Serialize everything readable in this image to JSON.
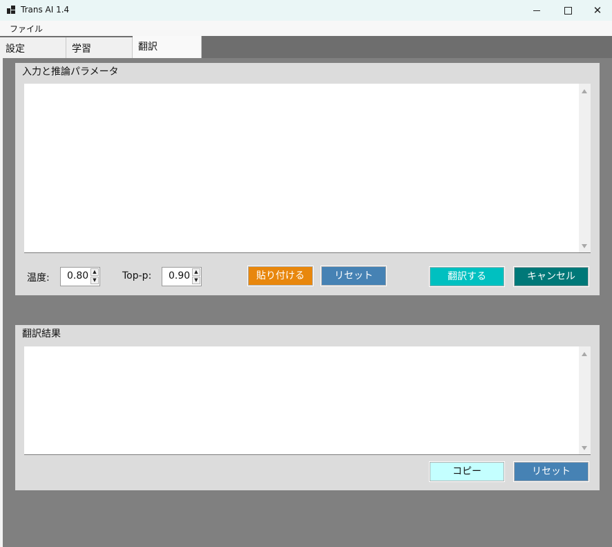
{
  "window": {
    "title": "Trans AI 1.4",
    "minimize_icon": "minimize-icon",
    "maximize_icon": "maximize-icon",
    "close_icon": "close-icon"
  },
  "menu": {
    "items": [
      {
        "label": "ファイル"
      }
    ]
  },
  "tabs": [
    {
      "label": "設定"
    },
    {
      "label": "学習"
    },
    {
      "label": "翻訳"
    }
  ],
  "active_tab": "翻訳",
  "input_group": {
    "title": "入力と推論パラメータ",
    "text": "",
    "temperature_label": "温度:",
    "temperature_value": "0.80",
    "top_p_label": "Top-p:",
    "top_p_value": "0.90",
    "paste_label": "貼り付ける",
    "reset_label": "リセット",
    "translate_label": "翻訳する",
    "cancel_label": "キャンセル"
  },
  "result_group": {
    "title": "翻訳結果",
    "text": "",
    "copy_label": "コピー",
    "reset_label": "リセット"
  },
  "colors": {
    "paste": "#e8870d",
    "reset": "#4682b4",
    "translate": "#00c0c0",
    "cancel": "#007878",
    "copy": "#c4ffff"
  }
}
